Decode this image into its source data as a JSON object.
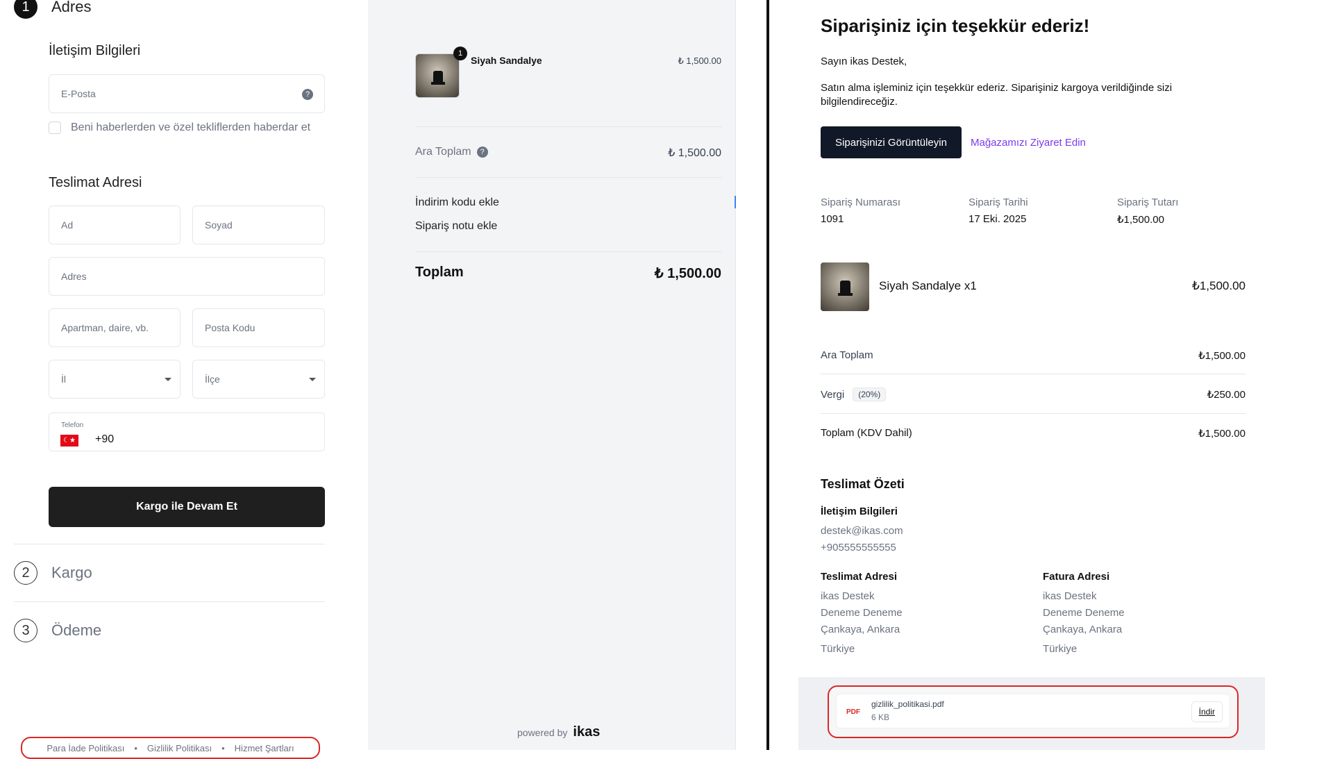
{
  "checkout": {
    "step1": {
      "num": "1",
      "label": "Adres"
    },
    "contact_title": "İletişim Bilgileri",
    "email_placeholder": "E-Posta",
    "newsletter_label": "Beni haberlerden ve özel tekliflerden haberdar et",
    "delivery_title": "Teslimat Adresi",
    "first_name_placeholder": "Ad",
    "last_name_placeholder": "Soyad",
    "address_placeholder": "Adres",
    "apartment_placeholder": "Apartman, daire, vb.",
    "postal_placeholder": "Posta Kodu",
    "city_placeholder": "İl",
    "district_placeholder": "İlçe",
    "phone_label": "Telefon",
    "phone_code": "+90",
    "continue_button": "Kargo ile Devam Et",
    "step2": {
      "num": "2",
      "label": "Kargo"
    },
    "step3": {
      "num": "3",
      "label": "Ödeme"
    },
    "footer_links": [
      "Para İade Politikası",
      "Gizlilik Politikası",
      "Hizmet Şartları"
    ],
    "footer_sep": "•"
  },
  "summary": {
    "item_name": "Siyah Sandalye",
    "item_qty_badge": "1",
    "item_price": "₺ 1,500.00",
    "subtotal_label": "Ara Toplam",
    "subtotal_value": "₺ 1,500.00",
    "discount_link": "İndirim kodu ekle",
    "note_link": "Sipariş notu ekle",
    "total_label": "Toplam",
    "total_value": "₺ 1,500.00",
    "powered_by": "powered by",
    "brand": "ikas"
  },
  "email": {
    "title": "Siparişiniz için teşekkür ederiz!",
    "greeting": "Sayın ikas Destek,",
    "message": "Satın alma işleminiz için teşekkür ederiz. Siparişiniz kargoya verildiğinde sizi bilgilendireceğiz.",
    "view_order_button": "Siparişinizi Görüntüleyin",
    "visit_store_link": "Mağazamızı Ziyaret Edin",
    "order_number_label": "Sipariş Numarası",
    "order_number": "1091",
    "order_date_label": "Sipariş Tarihi",
    "order_date": "17 Eki. 2025",
    "order_amount_label": "Sipariş Tutarı",
    "order_amount": "₺1,500.00",
    "item_line": "Siyah Sandalye x1",
    "item_price": "₺1,500.00",
    "subtotal_label": "Ara Toplam",
    "subtotal_value": "₺1,500.00",
    "tax_label": "Vergi",
    "tax_rate": "(20%)",
    "tax_value": "₺250.00",
    "total_label": "Toplam (KDV Dahil)",
    "total_value": "₺1,500.00",
    "delivery_summary_title": "Teslimat Özeti",
    "contact_title": "İletişim Bilgileri",
    "contact_email": "destek@ikas.com",
    "contact_phone": "+905555555555",
    "shipping_title": "Teslimat Adresi",
    "shipping_lines": [
      "ikas Destek",
      "Deneme Deneme",
      "Çankaya, Ankara",
      "Türkiye"
    ],
    "billing_title": "Fatura Adresi",
    "billing_lines": [
      "ikas Destek",
      "Deneme Deneme",
      "Çankaya, Ankara",
      "Türkiye"
    ],
    "attachment_type": "PDF",
    "attachment_name": "gizlilik_politikasi.pdf",
    "attachment_size": "6 KB",
    "attachment_download": "İndir"
  },
  "colors": {
    "accent_link": "#7c3aed",
    "primary_button": "#111827",
    "highlight_border": "#dc2626",
    "flag_red": "#e30a17"
  },
  "icons": [
    "help-icon",
    "chevron-down-icon",
    "turkey-flag-icon",
    "pdf-file-icon",
    "chair-thumbnail"
  ]
}
